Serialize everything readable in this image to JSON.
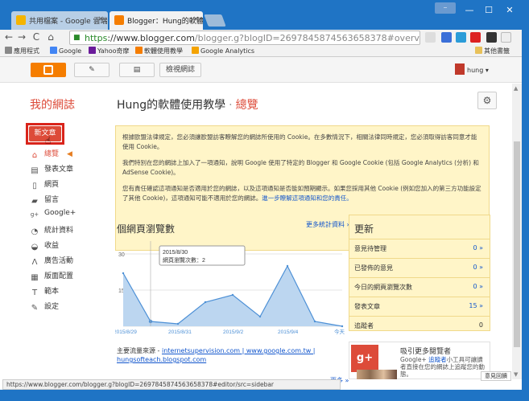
{
  "browser": {
    "tabs": [
      {
        "label": "共用檔案 - Google 雲端硬",
        "active": false
      },
      {
        "label": "Blogger：Hung的軟體使",
        "active": true
      }
    ],
    "url_https": "https",
    "url_main": "://www.blogger.com",
    "url_rest": "/blogger.g?blogID=2697845874563658378#overview/src=d",
    "user_chip": "⎯",
    "bookmarks": [
      {
        "label": "應用程式",
        "color": "#888"
      },
      {
        "label": "Google",
        "color": "#4285f4"
      },
      {
        "label": "Yahoo奇摩",
        "color": "#6a1b9a"
      },
      {
        "label": "軟體使用教學",
        "color": "#f57d00"
      },
      {
        "label": "Google Analytics",
        "color": "#f4a300"
      }
    ],
    "other_bookmarks": "其他書籤",
    "status_url": "https://www.blogger.com/blogger.g?blogID=2697845874563658378#editor/src=sidebar"
  },
  "blogger_bar": {
    "view_blog": "檢視網誌",
    "user": "hung"
  },
  "header": {
    "my_blogs": "我的網誌",
    "blog_title": "Hung的軟體使用教學",
    "separator": "·",
    "section": "總覽"
  },
  "sidebar": {
    "new_post": "新文章",
    "items": [
      {
        "label": "總覽",
        "icon": "home-icon",
        "glyph": "⌂"
      },
      {
        "label": "發表文章",
        "icon": "posts-icon",
        "glyph": "▤"
      },
      {
        "label": "網頁",
        "icon": "page-icon",
        "glyph": "▯"
      },
      {
        "label": "留言",
        "icon": "comment-icon",
        "glyph": "▰"
      },
      {
        "label": "Google+",
        "icon": "gplus-icon",
        "glyph": "g+"
      },
      {
        "label": "統計資料",
        "icon": "stats-icon",
        "glyph": "◔"
      },
      {
        "label": "收益",
        "icon": "earnings-icon",
        "glyph": "◒"
      },
      {
        "label": "廣告活動",
        "icon": "campaign-icon",
        "glyph": "Λ"
      },
      {
        "label": "版面配置",
        "icon": "layout-icon",
        "glyph": "▦"
      },
      {
        "label": "範本",
        "icon": "template-icon",
        "glyph": "T"
      },
      {
        "label": "設定",
        "icon": "settings-icon",
        "glyph": "✎"
      }
    ]
  },
  "notice": {
    "p1": "根據歐盟法律規定，您必須讓歐盟訪客瞭解您的網誌所使用的 Cookie。在多數情況下，相關法律同時規定，您必須取得訪客同意才能使用 Cookie。",
    "p2": "我們特別在您的網誌上加入了一項通知，說明 Google 使用了特定的 Blogger 和 Google Cookie (包括 Google Analytics (分析) 和 AdSense Cookie)。",
    "p3": "您有責任確認這項通知是否適用於您的網誌，以及這項通知是否能如預期顯示。如果您採用其他 Cookie (例如您加入的第三方功能設定了其他 Cookie)，這項通知可能不適用於您的網誌。",
    "p3_link": "進一步瞭解這項通知和您的責任。"
  },
  "stats": {
    "title": "個網頁瀏覽數",
    "more_link": "更多統計資料 »",
    "tooltip_date": "2015/8/30",
    "tooltip_value": "網頁瀏覽次數：2",
    "source_prefix": "主要流量來源 - ",
    "source_links": "internetsupervision.com | www.google.com.tw |",
    "source_link2": "hungsofteach.blogspot.com",
    "more2": "更多 »"
  },
  "chart_data": {
    "type": "area",
    "x": [
      "2015/8/29",
      "2015/8/30",
      "2015/8/31",
      "2015/9/1",
      "2015/9/2",
      "2015/9/3",
      "2015/9/4",
      "2015/9/5",
      "今天"
    ],
    "tick_labels": [
      "2015/8/29",
      "2015/8/31",
      "2015/9/2",
      "2015/9/4",
      "今天"
    ],
    "values": [
      22,
      2,
      1,
      10,
      13,
      4,
      25,
      2,
      0
    ],
    "ylim": [
      0,
      30
    ],
    "yticks": [
      0,
      15,
      30
    ],
    "color": "#4d90d6",
    "fill": "#bcd6f0"
  },
  "updates": {
    "title": "更新",
    "rows": [
      {
        "label": "意見待管理",
        "value": "0 »",
        "link": true
      },
      {
        "label": "已發佈的意見",
        "value": "0 »",
        "link": true
      },
      {
        "label": "今日的網頁瀏覽次數",
        "value": "0 »",
        "link": true
      },
      {
        "label": "發表文章",
        "value": "15 »",
        "link": true
      },
      {
        "label": "追蹤者",
        "value": "0",
        "link": false
      }
    ]
  },
  "gplus": {
    "logo": "g+",
    "title": "吸引更多閱覽者",
    "desc_prefix": "Google+ ",
    "desc_link": "追蹤者",
    "desc_rest": "小工具可讓讀者直接在您的網誌上追蹤您的",
    "desc_rest2": "動態。",
    "feedback": "意見回饋"
  },
  "colors": {
    "accent": "#dd4b39",
    "blogger_orange": "#f57d00",
    "link": "#1155cc",
    "notice_bg": "#fff5c8"
  }
}
